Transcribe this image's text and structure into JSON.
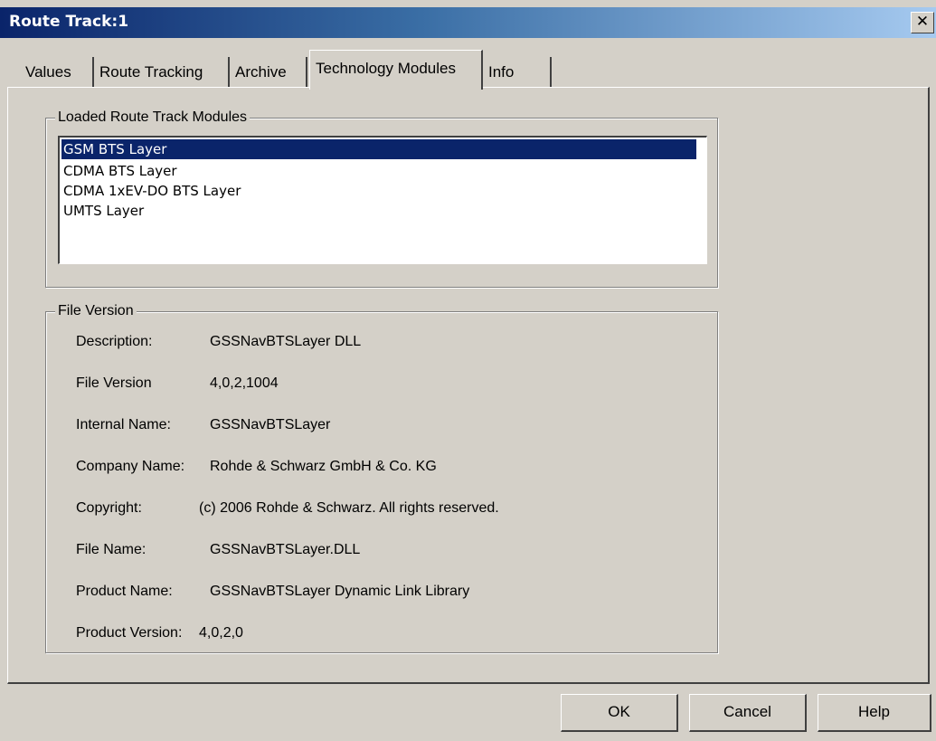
{
  "window": {
    "title": "Route Track:1",
    "close_glyph": "✕"
  },
  "tabs": [
    {
      "label": "Values"
    },
    {
      "label": "Route Tracking"
    },
    {
      "label": "Archive"
    },
    {
      "label": "Technology Modules",
      "active": true
    },
    {
      "label": "Info"
    }
  ],
  "modules": {
    "group_label": "Loaded Route Track Modules",
    "items": [
      "GSM BTS Layer",
      "CDMA BTS Layer",
      "CDMA 1xEV-DO BTS Layer",
      "UMTS Layer"
    ],
    "selected_index": 0
  },
  "file_version": {
    "group_label": "File Version",
    "rows": [
      {
        "label": "Description:",
        "value": "GSSNavBTSLayer DLL"
      },
      {
        "label": "File Version",
        "value": "4,0,2,1004"
      },
      {
        "label": "Internal Name:",
        "value": "GSSNavBTSLayer"
      },
      {
        "label": "Company Name:",
        "value": "Rohde & Schwarz GmbH & Co. KG"
      },
      {
        "label": "Copyright:",
        "value": "(c) 2006 Rohde & Schwarz. All rights reserved."
      },
      {
        "label": "File Name:",
        "value": "GSSNavBTSLayer.DLL"
      },
      {
        "label": "Product Name:",
        "value": "GSSNavBTSLayer Dynamic Link Library"
      },
      {
        "label": "Product Version:",
        "value": "4,0,2,0"
      }
    ]
  },
  "buttons": {
    "ok": "OK",
    "cancel": "Cancel",
    "help": "Help"
  },
  "colors": {
    "title_gradient_start": "#0a246a",
    "title_gradient_end": "#a6caf0",
    "face": "#d4d0c8",
    "selection": "#0a246a"
  }
}
